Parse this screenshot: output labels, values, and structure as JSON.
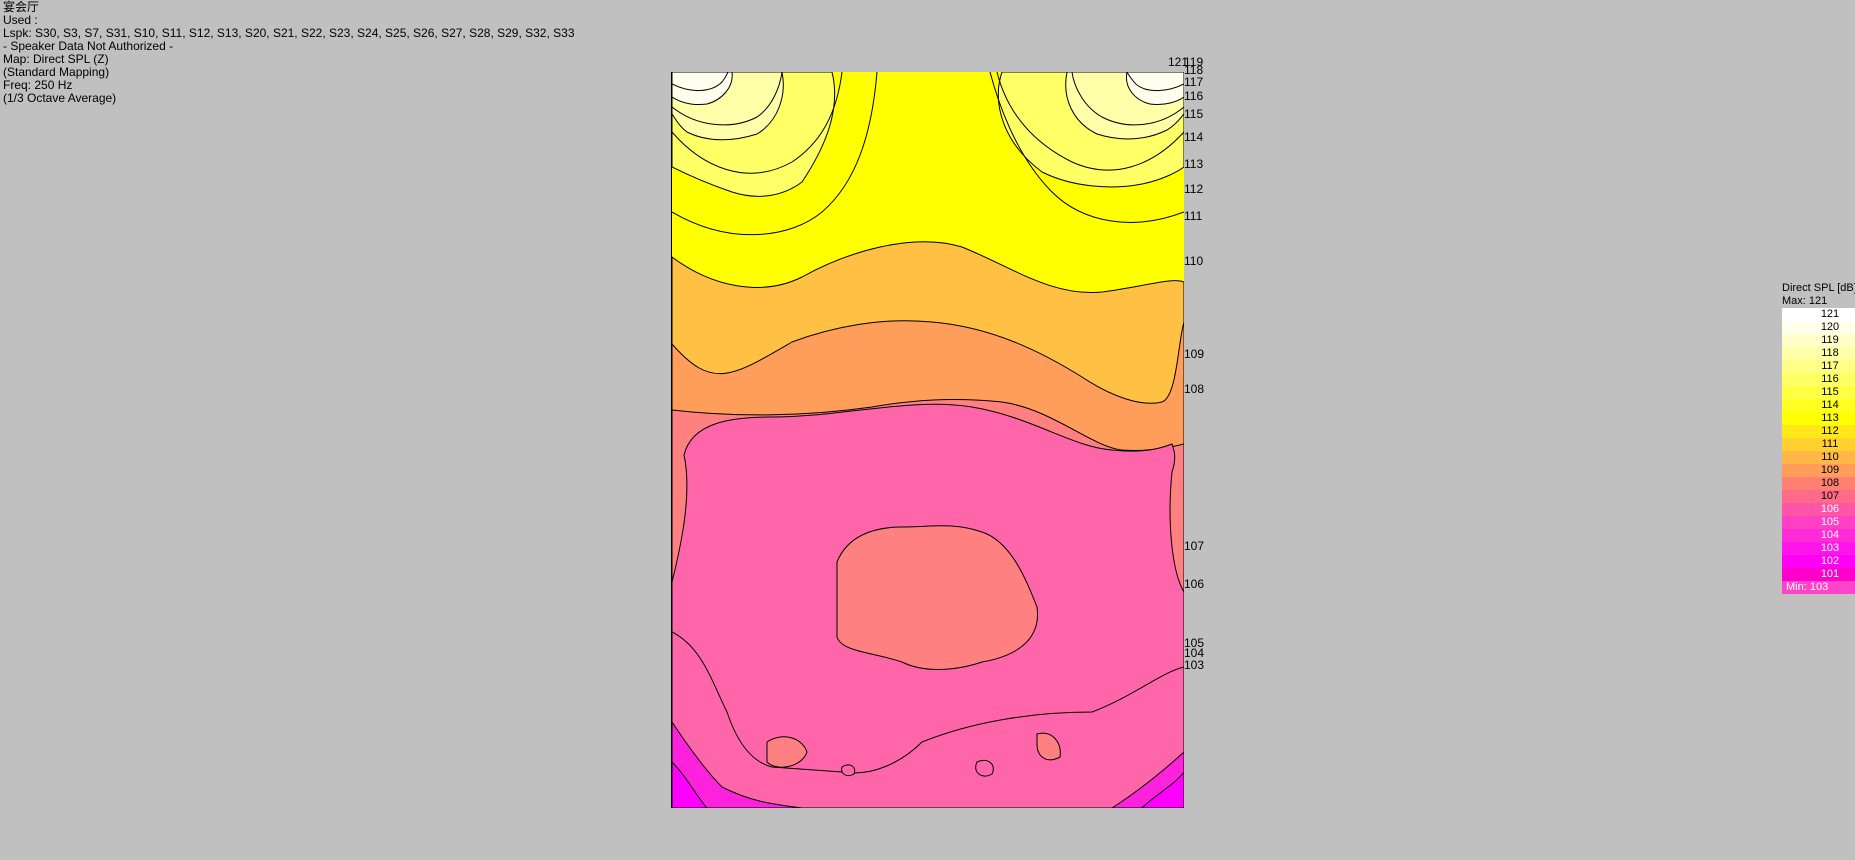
{
  "info": {
    "venue": "宴会厅",
    "used": "Used :",
    "loudspeakers": "Lspk: S30, S3, S7, S31, S10, S11, S12, S13, S20, S21, S22, S23, S24, S25, S26, S27, S28, S29, S32, S33",
    "speaker_data": "- Speaker Data Not Authorized -",
    "map": "Map: Direct SPL (Z)",
    "mapping": "(Standard Mapping)",
    "freq": "Freq: 250 Hz",
    "averaging": "(1/3 Octave Average)"
  },
  "chart_data": {
    "type": "heatmap",
    "title": "Direct SPL [dB]",
    "unit": "dB",
    "max": 121,
    "min": 103,
    "contour_labels": [
      "121",
      "119",
      "118",
      "117",
      "116",
      "115",
      "114",
      "113",
      "112",
      "111",
      "110",
      "109",
      "108",
      "107",
      "106",
      "105",
      "104",
      "103"
    ],
    "bands": [
      {
        "name": "band-114",
        "level": 114,
        "color": "#ffff66"
      },
      {
        "name": "band-112",
        "level": 112,
        "color": "#ffff00"
      },
      {
        "name": "band-111",
        "level": 111,
        "color": "#ffe81a"
      },
      {
        "name": "band-110",
        "level": 110,
        "color": "#ffc044"
      },
      {
        "name": "band-109",
        "level": 109,
        "color": "#ff9d5a"
      },
      {
        "name": "band-108",
        "level": 108,
        "color": "#ff8080"
      },
      {
        "name": "band-107",
        "level": 107,
        "color": "#ff66aa"
      },
      {
        "name": "band-105",
        "level": 105,
        "color": "#ff22dd"
      },
      {
        "name": "band-103",
        "level": 103,
        "color": "#ff00ff"
      }
    ]
  },
  "legend": {
    "title": "Direct SPL [dB]",
    "max_label": "Max:  121",
    "min_label": "Min:  103",
    "items": [
      {
        "value": "121",
        "color": "#ffffff",
        "text_color": "#000000"
      },
      {
        "value": "120",
        "color": "#ffffee",
        "text_color": "#000000"
      },
      {
        "value": "119",
        "color": "#ffffcc",
        "text_color": "#000000"
      },
      {
        "value": "118",
        "color": "#ffffaa",
        "text_color": "#000000"
      },
      {
        "value": "117",
        "color": "#ffff88",
        "text_color": "#000000"
      },
      {
        "value": "116",
        "color": "#ffff66",
        "text_color": "#000000"
      },
      {
        "value": "115",
        "color": "#ffff44",
        "text_color": "#000000"
      },
      {
        "value": "114",
        "color": "#ffff22",
        "text_color": "#000000"
      },
      {
        "value": "113",
        "color": "#ffff00",
        "text_color": "#000000"
      },
      {
        "value": "112",
        "color": "#ffe81a",
        "text_color": "#000000"
      },
      {
        "value": "111",
        "color": "#ffd030",
        "text_color": "#000000"
      },
      {
        "value": "110",
        "color": "#ffb848",
        "text_color": "#000000"
      },
      {
        "value": "109",
        "color": "#ff9d5a",
        "text_color": "#000000"
      },
      {
        "value": "108",
        "color": "#ff8070",
        "text_color": "#000000"
      },
      {
        "value": "107",
        "color": "#ff6a88",
        "text_color": "#000000"
      },
      {
        "value": "106",
        "color": "#ff55a8",
        "text_color": "#ffffff"
      },
      {
        "value": "105",
        "color": "#ff40c4",
        "text_color": "#ffffff"
      },
      {
        "value": "104",
        "color": "#ff2ad8",
        "text_color": "#ffffff"
      },
      {
        "value": "103",
        "color": "#ff15ec",
        "text_color": "#ffffff"
      },
      {
        "value": "102",
        "color": "#ff00f4",
        "text_color": "#ffffff"
      },
      {
        "value": "101",
        "color": "#ff00cc",
        "text_color": "#ffffff"
      }
    ]
  }
}
